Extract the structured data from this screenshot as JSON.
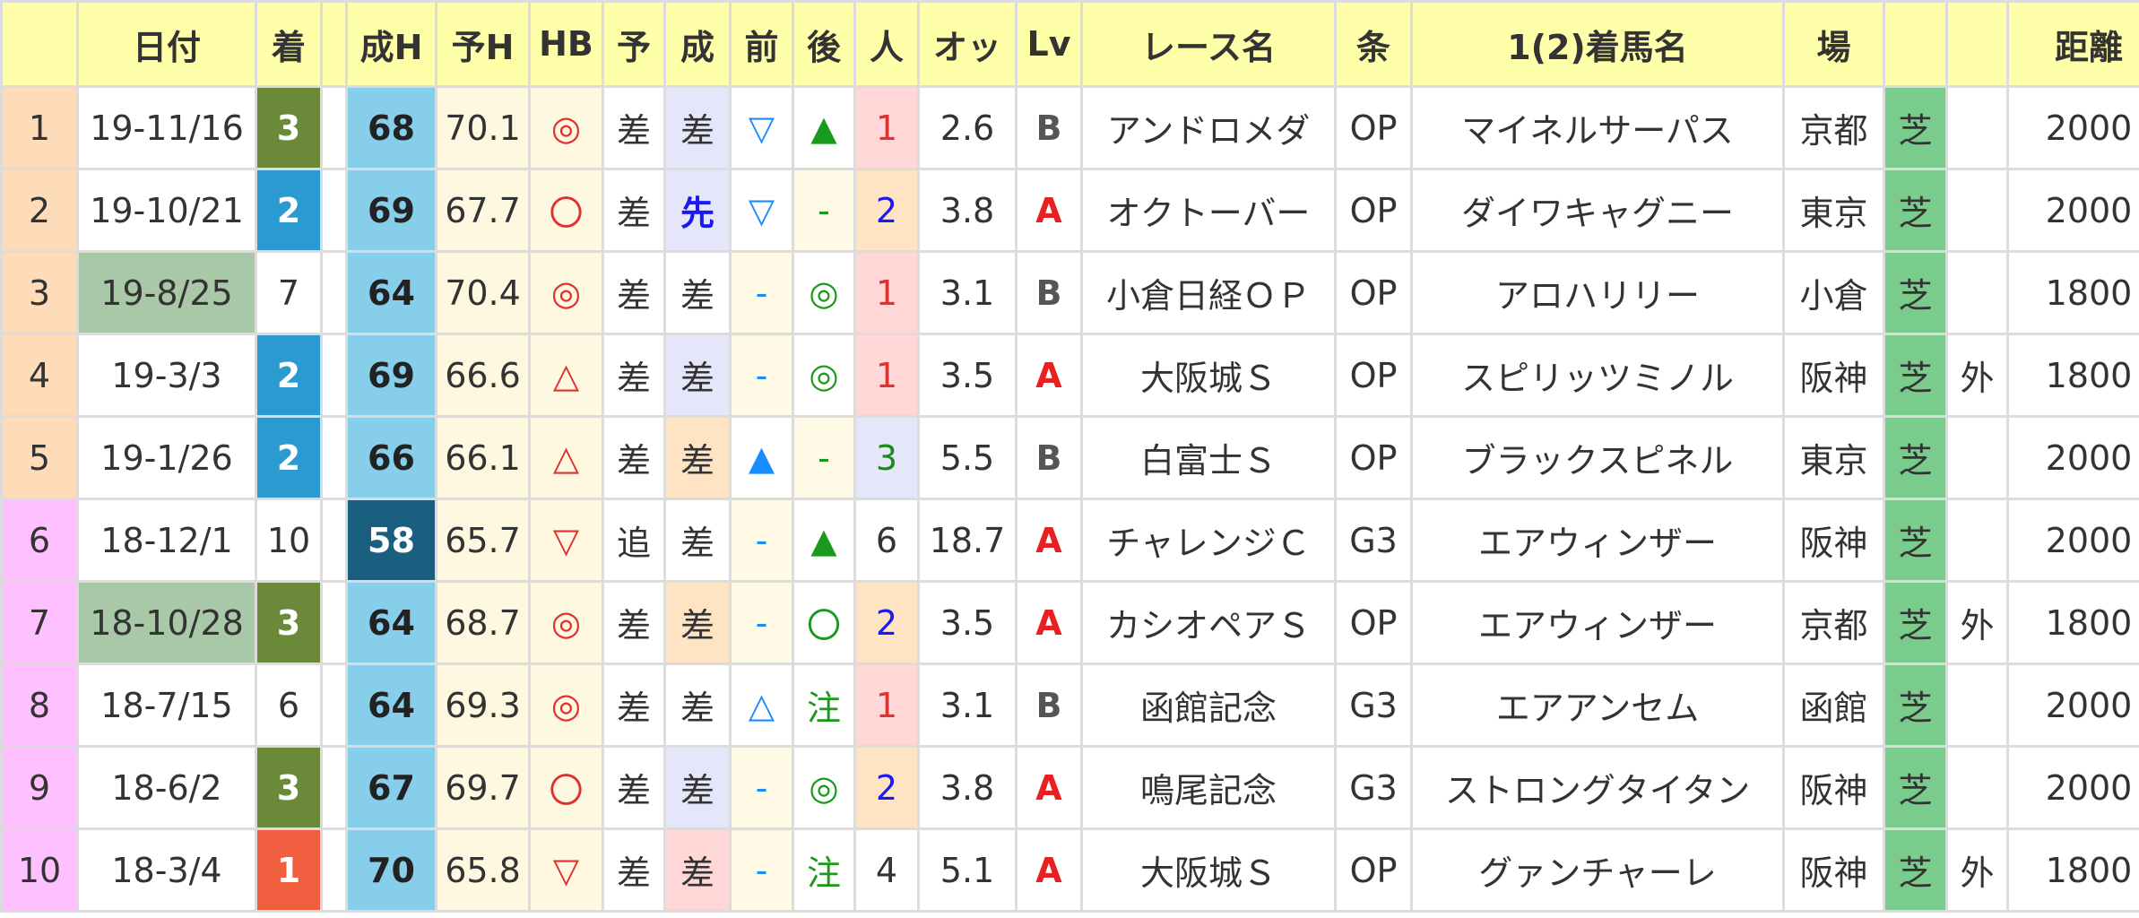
{
  "headers": [
    "",
    "日付",
    "着",
    "",
    "成H",
    "予H",
    "HB",
    "予",
    "成",
    "前",
    "後",
    "人",
    "オッ",
    "Lv",
    "レース名",
    "条",
    "1(2)着馬名",
    "場",
    "",
    "",
    "距離"
  ],
  "rows": [
    {
      "no": "1",
      "date": "19-11/16",
      "place": "3",
      "ach": "68",
      "pred": "70.1",
      "hb": "◎",
      "yo": "差",
      "sei": "差",
      "mae": "▽",
      "ato": "▲",
      "pop": "1",
      "odds": "2.6",
      "lv": "B",
      "race": "アンドロメダ",
      "cls": "OP",
      "horse": "マイネルサーパス",
      "venue": "京都",
      "track": "芝",
      "course": "",
      "dist": "2000"
    },
    {
      "no": "2",
      "date": "19-10/21",
      "place": "2",
      "ach": "69",
      "pred": "67.7",
      "hb": "〇",
      "yo": "差",
      "sei": "先",
      "mae": "▽",
      "ato": "-",
      "pop": "2",
      "odds": "3.8",
      "lv": "A",
      "race": "オクトーバー",
      "cls": "OP",
      "horse": "ダイワキャグニー",
      "venue": "東京",
      "track": "芝",
      "course": "",
      "dist": "2000"
    },
    {
      "no": "3",
      "date": "19-8/25",
      "place": "7",
      "ach": "64",
      "pred": "70.4",
      "hb": "◎",
      "yo": "差",
      "sei": "差",
      "mae": "-",
      "ato": "◎",
      "pop": "1",
      "odds": "3.1",
      "lv": "B",
      "race": "小倉日経ＯＰ",
      "cls": "OP",
      "horse": "アロハリリー",
      "venue": "小倉",
      "track": "芝",
      "course": "",
      "dist": "1800"
    },
    {
      "no": "4",
      "date": "19-3/3",
      "place": "2",
      "ach": "69",
      "pred": "66.6",
      "hb": "△",
      "yo": "差",
      "sei": "差",
      "mae": "-",
      "ato": "◎",
      "pop": "1",
      "odds": "3.5",
      "lv": "A",
      "race": "大阪城Ｓ",
      "cls": "OP",
      "horse": "スピリッツミノル",
      "venue": "阪神",
      "track": "芝",
      "course": "外",
      "dist": "1800"
    },
    {
      "no": "5",
      "date": "19-1/26",
      "place": "2",
      "ach": "66",
      "pred": "66.1",
      "hb": "△",
      "yo": "差",
      "sei": "差",
      "mae": "▲",
      "ato": "-",
      "pop": "3",
      "odds": "5.5",
      "lv": "B",
      "race": "白富士Ｓ",
      "cls": "OP",
      "horse": "ブラックスピネル",
      "venue": "東京",
      "track": "芝",
      "course": "",
      "dist": "2000"
    },
    {
      "no": "6",
      "date": "18-12/1",
      "place": "10",
      "ach": "58",
      "pred": "65.7",
      "hb": "▽",
      "yo": "追",
      "sei": "差",
      "mae": "-",
      "ato": "▲",
      "pop": "6",
      "odds": "18.7",
      "lv": "A",
      "race": "チャレンジＣ",
      "cls": "G3",
      "horse": "エアウィンザー",
      "venue": "阪神",
      "track": "芝",
      "course": "",
      "dist": "2000"
    },
    {
      "no": "7",
      "date": "18-10/28",
      "place": "3",
      "ach": "64",
      "pred": "68.7",
      "hb": "◎",
      "yo": "差",
      "sei": "差",
      "mae": "-",
      "ato": "〇",
      "pop": "2",
      "odds": "3.5",
      "lv": "A",
      "race": "カシオペアＳ",
      "cls": "OP",
      "horse": "エアウィンザー",
      "venue": "京都",
      "track": "芝",
      "course": "外",
      "dist": "1800"
    },
    {
      "no": "8",
      "date": "18-7/15",
      "place": "6",
      "ach": "64",
      "pred": "69.3",
      "hb": "◎",
      "yo": "差",
      "sei": "差",
      "mae": "△",
      "ato": "注",
      "pop": "1",
      "odds": "3.1",
      "lv": "B",
      "race": "函館記念",
      "cls": "G3",
      "horse": "エアアンセム",
      "venue": "函館",
      "track": "芝",
      "course": "",
      "dist": "2000"
    },
    {
      "no": "9",
      "date": "18-6/2",
      "place": "3",
      "ach": "67",
      "pred": "69.7",
      "hb": "〇",
      "yo": "差",
      "sei": "差",
      "mae": "-",
      "ato": "◎",
      "pop": "2",
      "odds": "3.8",
      "lv": "A",
      "race": "鳴尾記念",
      "cls": "G3",
      "horse": "ストロングタイタン",
      "venue": "阪神",
      "track": "芝",
      "course": "",
      "dist": "2000"
    },
    {
      "no": "10",
      "date": "18-3/4",
      "place": "1",
      "ach": "70",
      "pred": "65.8",
      "hb": "▽",
      "yo": "差",
      "sei": "差",
      "mae": "-",
      "ato": "注",
      "pop": "4",
      "odds": "5.1",
      "lv": "A",
      "race": "大阪城Ｓ",
      "cls": "OP",
      "horse": "グァンチャーレ",
      "venue": "阪神",
      "track": "芝",
      "course": "外",
      "dist": "1800"
    }
  ],
  "colors": {
    "header_bg": "#ffffaa",
    "grid_border": "#dcdcdc",
    "no_peach": "#ffdcb9",
    "no_pink": "#ffc0ff",
    "date_highlight": "#a8c8a8",
    "place_first": "#f06040",
    "place_second": "#2a9ad0",
    "place_third": "#6a8a3a",
    "ach_light": "#87ceeb",
    "ach_dark": "#1a5f7f",
    "pred_bg": "#fff8e0",
    "hb_bg": "#fff8e0",
    "hb_red": "#e03030",
    "sei_lavender": "#e6e6fa",
    "sei_peach": "#ffe4c4",
    "sei_pink": "#ffd7d7",
    "sei_senkou_text": "#1a1af0",
    "mae_ato_blue": "#1a8cff",
    "mae_ato_green": "#1a9a1a",
    "mae_ato_dash_bg": "#fffae6",
    "pop_red": "#ffd7d7",
    "pop_peach": "#ffe4c4",
    "pop_lavender": "#e6e6fa",
    "lv_a": "#e82020",
    "lv_b": "#555555",
    "track_turf": "#7acc8c"
  }
}
